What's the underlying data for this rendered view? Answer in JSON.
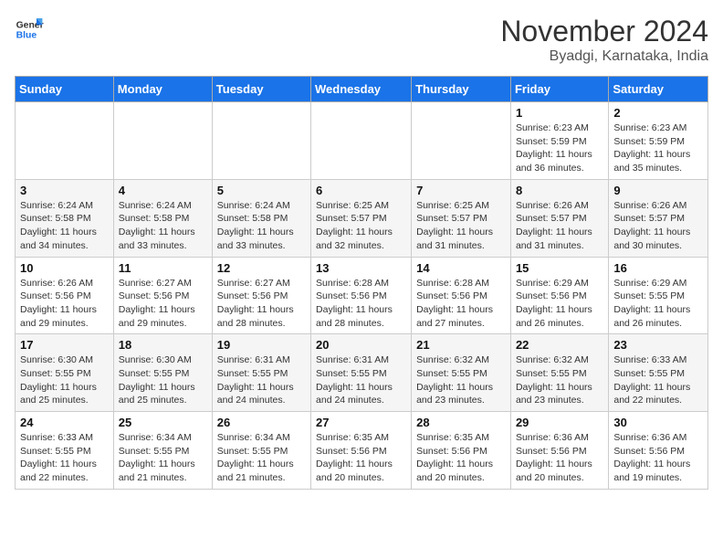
{
  "header": {
    "logo_line1": "General",
    "logo_line2": "Blue",
    "month": "November 2024",
    "location": "Byadgi, Karnataka, India"
  },
  "weekdays": [
    "Sunday",
    "Monday",
    "Tuesday",
    "Wednesday",
    "Thursday",
    "Friday",
    "Saturday"
  ],
  "weeks": [
    [
      {
        "day": "",
        "info": ""
      },
      {
        "day": "",
        "info": ""
      },
      {
        "day": "",
        "info": ""
      },
      {
        "day": "",
        "info": ""
      },
      {
        "day": "",
        "info": ""
      },
      {
        "day": "1",
        "info": "Sunrise: 6:23 AM\nSunset: 5:59 PM\nDaylight: 11 hours\nand 36 minutes."
      },
      {
        "day": "2",
        "info": "Sunrise: 6:23 AM\nSunset: 5:59 PM\nDaylight: 11 hours\nand 35 minutes."
      }
    ],
    [
      {
        "day": "3",
        "info": "Sunrise: 6:24 AM\nSunset: 5:58 PM\nDaylight: 11 hours\nand 34 minutes."
      },
      {
        "day": "4",
        "info": "Sunrise: 6:24 AM\nSunset: 5:58 PM\nDaylight: 11 hours\nand 33 minutes."
      },
      {
        "day": "5",
        "info": "Sunrise: 6:24 AM\nSunset: 5:58 PM\nDaylight: 11 hours\nand 33 minutes."
      },
      {
        "day": "6",
        "info": "Sunrise: 6:25 AM\nSunset: 5:57 PM\nDaylight: 11 hours\nand 32 minutes."
      },
      {
        "day": "7",
        "info": "Sunrise: 6:25 AM\nSunset: 5:57 PM\nDaylight: 11 hours\nand 31 minutes."
      },
      {
        "day": "8",
        "info": "Sunrise: 6:26 AM\nSunset: 5:57 PM\nDaylight: 11 hours\nand 31 minutes."
      },
      {
        "day": "9",
        "info": "Sunrise: 6:26 AM\nSunset: 5:57 PM\nDaylight: 11 hours\nand 30 minutes."
      }
    ],
    [
      {
        "day": "10",
        "info": "Sunrise: 6:26 AM\nSunset: 5:56 PM\nDaylight: 11 hours\nand 29 minutes."
      },
      {
        "day": "11",
        "info": "Sunrise: 6:27 AM\nSunset: 5:56 PM\nDaylight: 11 hours\nand 29 minutes."
      },
      {
        "day": "12",
        "info": "Sunrise: 6:27 AM\nSunset: 5:56 PM\nDaylight: 11 hours\nand 28 minutes."
      },
      {
        "day": "13",
        "info": "Sunrise: 6:28 AM\nSunset: 5:56 PM\nDaylight: 11 hours\nand 28 minutes."
      },
      {
        "day": "14",
        "info": "Sunrise: 6:28 AM\nSunset: 5:56 PM\nDaylight: 11 hours\nand 27 minutes."
      },
      {
        "day": "15",
        "info": "Sunrise: 6:29 AM\nSunset: 5:56 PM\nDaylight: 11 hours\nand 26 minutes."
      },
      {
        "day": "16",
        "info": "Sunrise: 6:29 AM\nSunset: 5:55 PM\nDaylight: 11 hours\nand 26 minutes."
      }
    ],
    [
      {
        "day": "17",
        "info": "Sunrise: 6:30 AM\nSunset: 5:55 PM\nDaylight: 11 hours\nand 25 minutes."
      },
      {
        "day": "18",
        "info": "Sunrise: 6:30 AM\nSunset: 5:55 PM\nDaylight: 11 hours\nand 25 minutes."
      },
      {
        "day": "19",
        "info": "Sunrise: 6:31 AM\nSunset: 5:55 PM\nDaylight: 11 hours\nand 24 minutes."
      },
      {
        "day": "20",
        "info": "Sunrise: 6:31 AM\nSunset: 5:55 PM\nDaylight: 11 hours\nand 24 minutes."
      },
      {
        "day": "21",
        "info": "Sunrise: 6:32 AM\nSunset: 5:55 PM\nDaylight: 11 hours\nand 23 minutes."
      },
      {
        "day": "22",
        "info": "Sunrise: 6:32 AM\nSunset: 5:55 PM\nDaylight: 11 hours\nand 23 minutes."
      },
      {
        "day": "23",
        "info": "Sunrise: 6:33 AM\nSunset: 5:55 PM\nDaylight: 11 hours\nand 22 minutes."
      }
    ],
    [
      {
        "day": "24",
        "info": "Sunrise: 6:33 AM\nSunset: 5:55 PM\nDaylight: 11 hours\nand 22 minutes."
      },
      {
        "day": "25",
        "info": "Sunrise: 6:34 AM\nSunset: 5:55 PM\nDaylight: 11 hours\nand 21 minutes."
      },
      {
        "day": "26",
        "info": "Sunrise: 6:34 AM\nSunset: 5:55 PM\nDaylight: 11 hours\nand 21 minutes."
      },
      {
        "day": "27",
        "info": "Sunrise: 6:35 AM\nSunset: 5:56 PM\nDaylight: 11 hours\nand 20 minutes."
      },
      {
        "day": "28",
        "info": "Sunrise: 6:35 AM\nSunset: 5:56 PM\nDaylight: 11 hours\nand 20 minutes."
      },
      {
        "day": "29",
        "info": "Sunrise: 6:36 AM\nSunset: 5:56 PM\nDaylight: 11 hours\nand 20 minutes."
      },
      {
        "day": "30",
        "info": "Sunrise: 6:36 AM\nSunset: 5:56 PM\nDaylight: 11 hours\nand 19 minutes."
      }
    ]
  ]
}
